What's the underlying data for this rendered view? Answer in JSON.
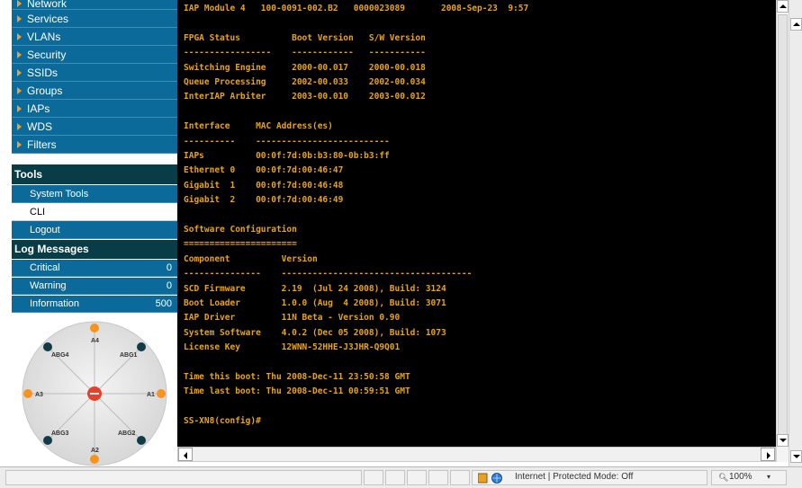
{
  "sidebar": {
    "nav_items": [
      {
        "label": "Network"
      },
      {
        "label": "Services"
      },
      {
        "label": "VLANs"
      },
      {
        "label": "Security"
      },
      {
        "label": "SSIDs"
      },
      {
        "label": "Groups"
      },
      {
        "label": "IAPs"
      },
      {
        "label": "WDS"
      },
      {
        "label": "Filters"
      }
    ],
    "tools": {
      "header": "Tools",
      "items": [
        {
          "label": "System Tools"
        },
        {
          "label": "CLI"
        },
        {
          "label": "Logout"
        }
      ]
    },
    "log_messages": {
      "header": "Log Messages",
      "items": [
        {
          "label": "Critical",
          "count": "0"
        },
        {
          "label": "Warning",
          "count": "0"
        },
        {
          "label": "Information",
          "count": "500"
        }
      ]
    }
  },
  "antenna": {
    "labels": {
      "a4": "A4",
      "abg4": "ABG4",
      "abg1": "ABG1",
      "a3": "A3",
      "a1": "A1",
      "abg3": "ABG3",
      "abg2": "ABG2",
      "a2": "A2"
    },
    "colors": {
      "orange": "#f7931e",
      "dark": "#123b4a",
      "center": "#e8412b"
    }
  },
  "terminal": {
    "lines": [
      "IAP Module 4   100-0091-002.B2   0000023089       2008-Sep-23  9:57",
      "",
      "FPGA Status          Boot Version   S/W Version",
      "-----------------    ------------   -----------",
      "Switching Engine     2000-00.017    2000-00.018",
      "Queue Processing     2002-00.033    2002-00.034",
      "InterIAP Arbiter     2003-00.010    2003-00.012",
      "",
      "Interface     MAC Address(es)",
      "----------    --------------------------",
      "IAPs          00:0f:7d:0b:b3:80-0b:b3:ff",
      "Ethernet 0    00:0f:7d:00:46:47",
      "Gigabit  1    00:0f:7d:00:46:48",
      "Gigabit  2    00:0f:7d:00:46:49",
      "",
      "Software Configuration",
      "======================",
      "Component          Version",
      "---------------    -------------------------------------",
      "SCD Firmware       2.19  (Jul 24 2008), Build: 3124",
      "Boot Loader        1.0.0 (Aug  4 2008), Build: 3071",
      "IAP Driver         11N Beta - Version 0.90",
      "System Software    4.0.2 (Dec 05 2008), Build: 1073",
      "License Key        12WNN-52HHE-J3JHR-Q9Q01",
      "",
      "Time this boot: Thu 2008-Dec-11 23:50:58 GMT",
      "Time last boot: Thu 2008-Dec-11 00:59:51 GMT",
      "",
      "SS-XN8(config)#"
    ],
    "text_color": "#e8a410"
  },
  "statusbar": {
    "zone": "Internet | Protected Mode: Off",
    "zoom": "100%"
  }
}
